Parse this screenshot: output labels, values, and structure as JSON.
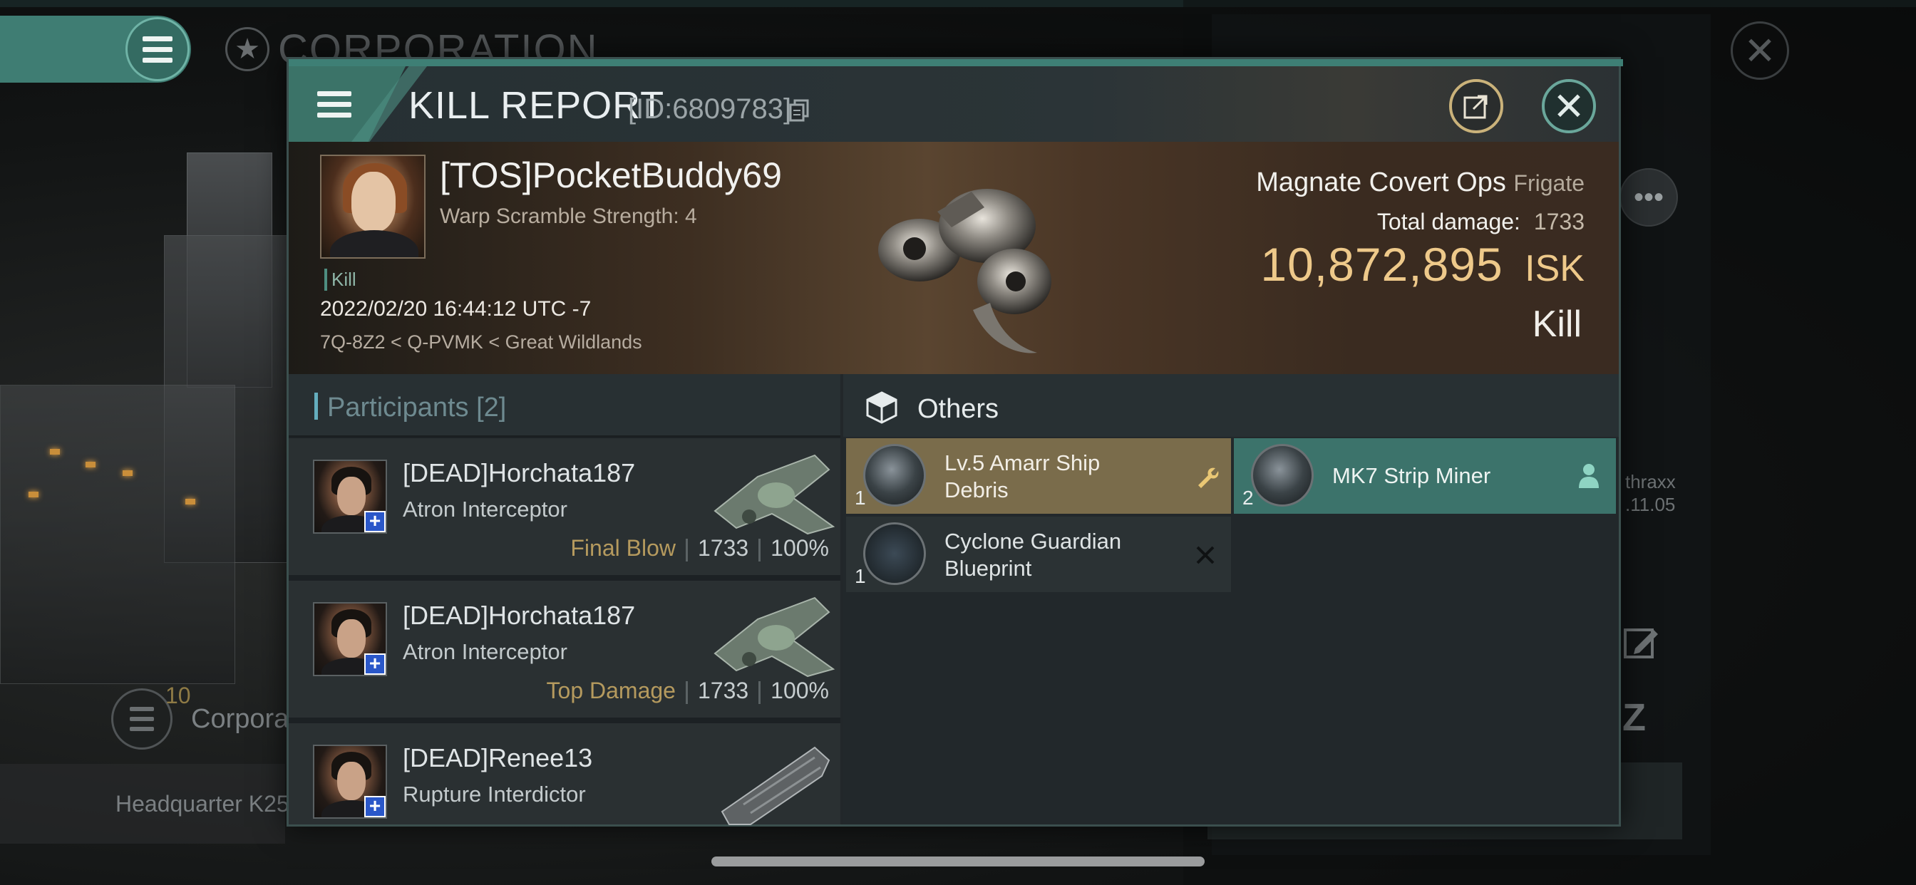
{
  "background": {
    "corp_title": "CORPORATION",
    "corp_badge_number": "10",
    "corp_label": "Corpora",
    "hq_label": "Headquarter K25",
    "side_name": "thraxx",
    "side_date": ".11.05"
  },
  "modal": {
    "title": "KILL REPORT",
    "report_id": "[ID:6809783]"
  },
  "victim": {
    "name": "[TOS]PocketBuddy69",
    "warp_scramble": "Warp Scramble Strength: 4",
    "kill_tag": "Kill",
    "datetime": "2022/02/20 16:44:12 UTC -7",
    "location": "7Q-8Z2 < Q-PVMK < Great Wildlands",
    "ship_name": "Magnate Covert Ops",
    "ship_class": "Frigate",
    "total_damage_label": "Total damage:",
    "total_damage": "1733",
    "isk_value": "10,872,895",
    "isk_unit": "ISK",
    "result": "Kill"
  },
  "participants": {
    "title": "Participants [2]",
    "rows": [
      {
        "name": "[DEAD]Horchata187",
        "ship": "Atron Interceptor",
        "badge": "Final Blow",
        "damage": "1733",
        "percent": "100%"
      },
      {
        "name": "[DEAD]Horchata187",
        "ship": "Atron Interceptor",
        "badge": "Top Damage",
        "damage": "1733",
        "percent": "100%"
      },
      {
        "name": "[DEAD]Renee13",
        "ship": "Rupture Interdictor"
      }
    ]
  },
  "others": {
    "title": "Others",
    "items": [
      {
        "qty": "1",
        "label_line1": "Lv.5 Amarr Ship",
        "label_line2": "Debris",
        "status_icon": "wrench-icon"
      },
      {
        "qty": "2",
        "label_line1": "MK7 Strip Miner",
        "status_icon": "person-icon"
      },
      {
        "qty": "1",
        "label_line1": "Cyclone Guardian",
        "label_line2": "Blueprint",
        "status_icon": "close-x-icon"
      }
    ]
  },
  "colors": {
    "accent_teal": "#3e7f75",
    "isk_gold": "#eec98a",
    "badge_gold": "#b59a5e",
    "item_gold_bg": "#7a6c4b",
    "item_teal_bg": "#3c736b"
  }
}
